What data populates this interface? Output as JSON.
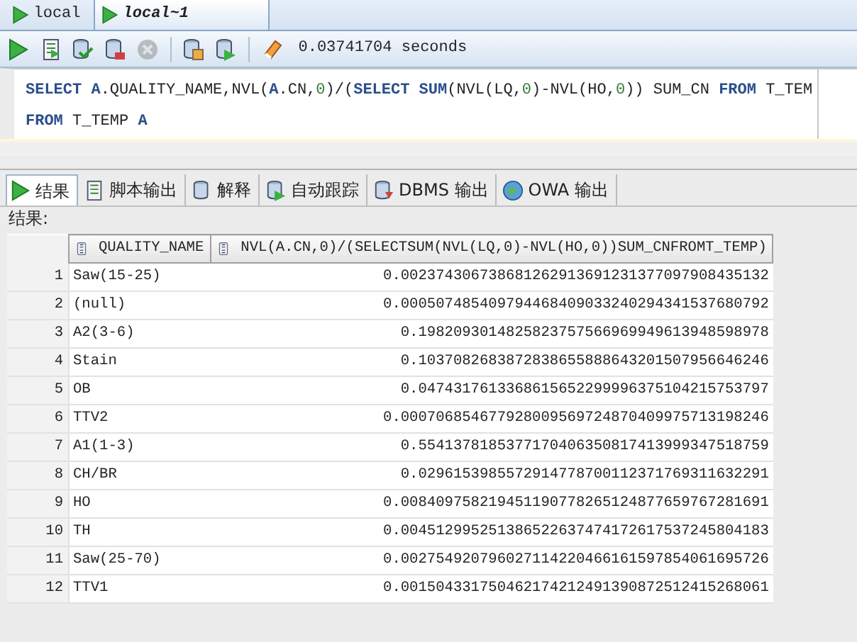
{
  "doc_tabs": [
    {
      "label": "local",
      "selected": false
    },
    {
      "label": "local~1",
      "selected": true
    }
  ],
  "toolbar": {
    "buttons": [
      {
        "disabled": false
      },
      {
        "disabled": false
      },
      {
        "disabled": false
      },
      {
        "disabled": false
      },
      {
        "disabled": true
      },
      {
        "disabled": false
      },
      {
        "disabled": false
      },
      {
        "disabled": false
      }
    ],
    "timing": "0.03741704 seconds"
  },
  "editor": {
    "lines": [
      [
        {
          "kind": "keyword",
          "text": "SELECT "
        },
        {
          "kind": "alias",
          "text": "A"
        },
        {
          "kind": "plain",
          "text": ".QUALITY_NAME,NVL("
        },
        {
          "kind": "alias",
          "text": "A"
        },
        {
          "kind": "plain",
          "text": ".CN,"
        },
        {
          "kind": "number",
          "text": "0"
        },
        {
          "kind": "plain",
          "text": ")/("
        },
        {
          "kind": "keyword",
          "text": "SELECT SUM"
        },
        {
          "kind": "plain",
          "text": "(NVL(LQ,"
        },
        {
          "kind": "number",
          "text": "0"
        },
        {
          "kind": "plain",
          "text": ")-NVL(HO,"
        },
        {
          "kind": "number",
          "text": "0"
        },
        {
          "kind": "plain",
          "text": ")) SUM_CN "
        },
        {
          "kind": "keyword",
          "text": "FROM"
        },
        {
          "kind": "plain",
          "text": " T_TEM"
        }
      ],
      [
        {
          "kind": "keyword",
          "text": "FROM"
        },
        {
          "kind": "plain",
          "text": " T_TEMP "
        },
        {
          "kind": "alias",
          "text": "A"
        }
      ]
    ]
  },
  "result_tabs": [
    {
      "label": "结果",
      "selected": true
    },
    {
      "label": "脚本输出",
      "selected": false
    },
    {
      "label": "解释",
      "selected": false
    },
    {
      "label": "自动跟踪",
      "selected": false
    },
    {
      "label": "DBMS 输出",
      "selected": false
    },
    {
      "label": "OWA 输出",
      "selected": false
    }
  ],
  "result_label": "结果:",
  "table": {
    "columns": [
      "",
      "QUALITY_NAME",
      "NVL(A.CN,0)/(SELECTSUM(NVL(LQ,0)-NVL(HO,0))SUM_CNFROMT_TEMP)"
    ],
    "rows": [
      [
        "1",
        "Saw(15-25)",
        "0.002374306738681262913691231377097908435132"
      ],
      [
        "2",
        "(null)",
        "0.000507485409794468409033240294341537680792"
      ],
      [
        "3",
        "A2(3-6)",
        "0.1982093014825823757566969949613948598978"
      ],
      [
        "4",
        "Stain",
        "0.1037082683872838655888643201507956646246"
      ],
      [
        "5",
        "OB",
        "0.0474317613368615652299996375104215753797"
      ],
      [
        "6",
        "TTV2",
        "0.000706854677928009569724870409975713198246"
      ],
      [
        "7",
        "A1(1-3)",
        "0.5541378185377170406350817413999347518759"
      ],
      [
        "8",
        "CH/BR",
        "0.0296153985572914778700112371769311632291"
      ],
      [
        "9",
        "HO",
        "0.008409758219451190778265124877659767281691"
      ],
      [
        "10",
        "TH",
        "0.004512995251386522637474172617537245804183"
      ],
      [
        "11",
        "Saw(25-70)",
        "0.002754920796027114220466161597854061695726"
      ],
      [
        "12",
        "TTV1",
        "0.001504331750462174212491390872512415268061"
      ]
    ]
  }
}
